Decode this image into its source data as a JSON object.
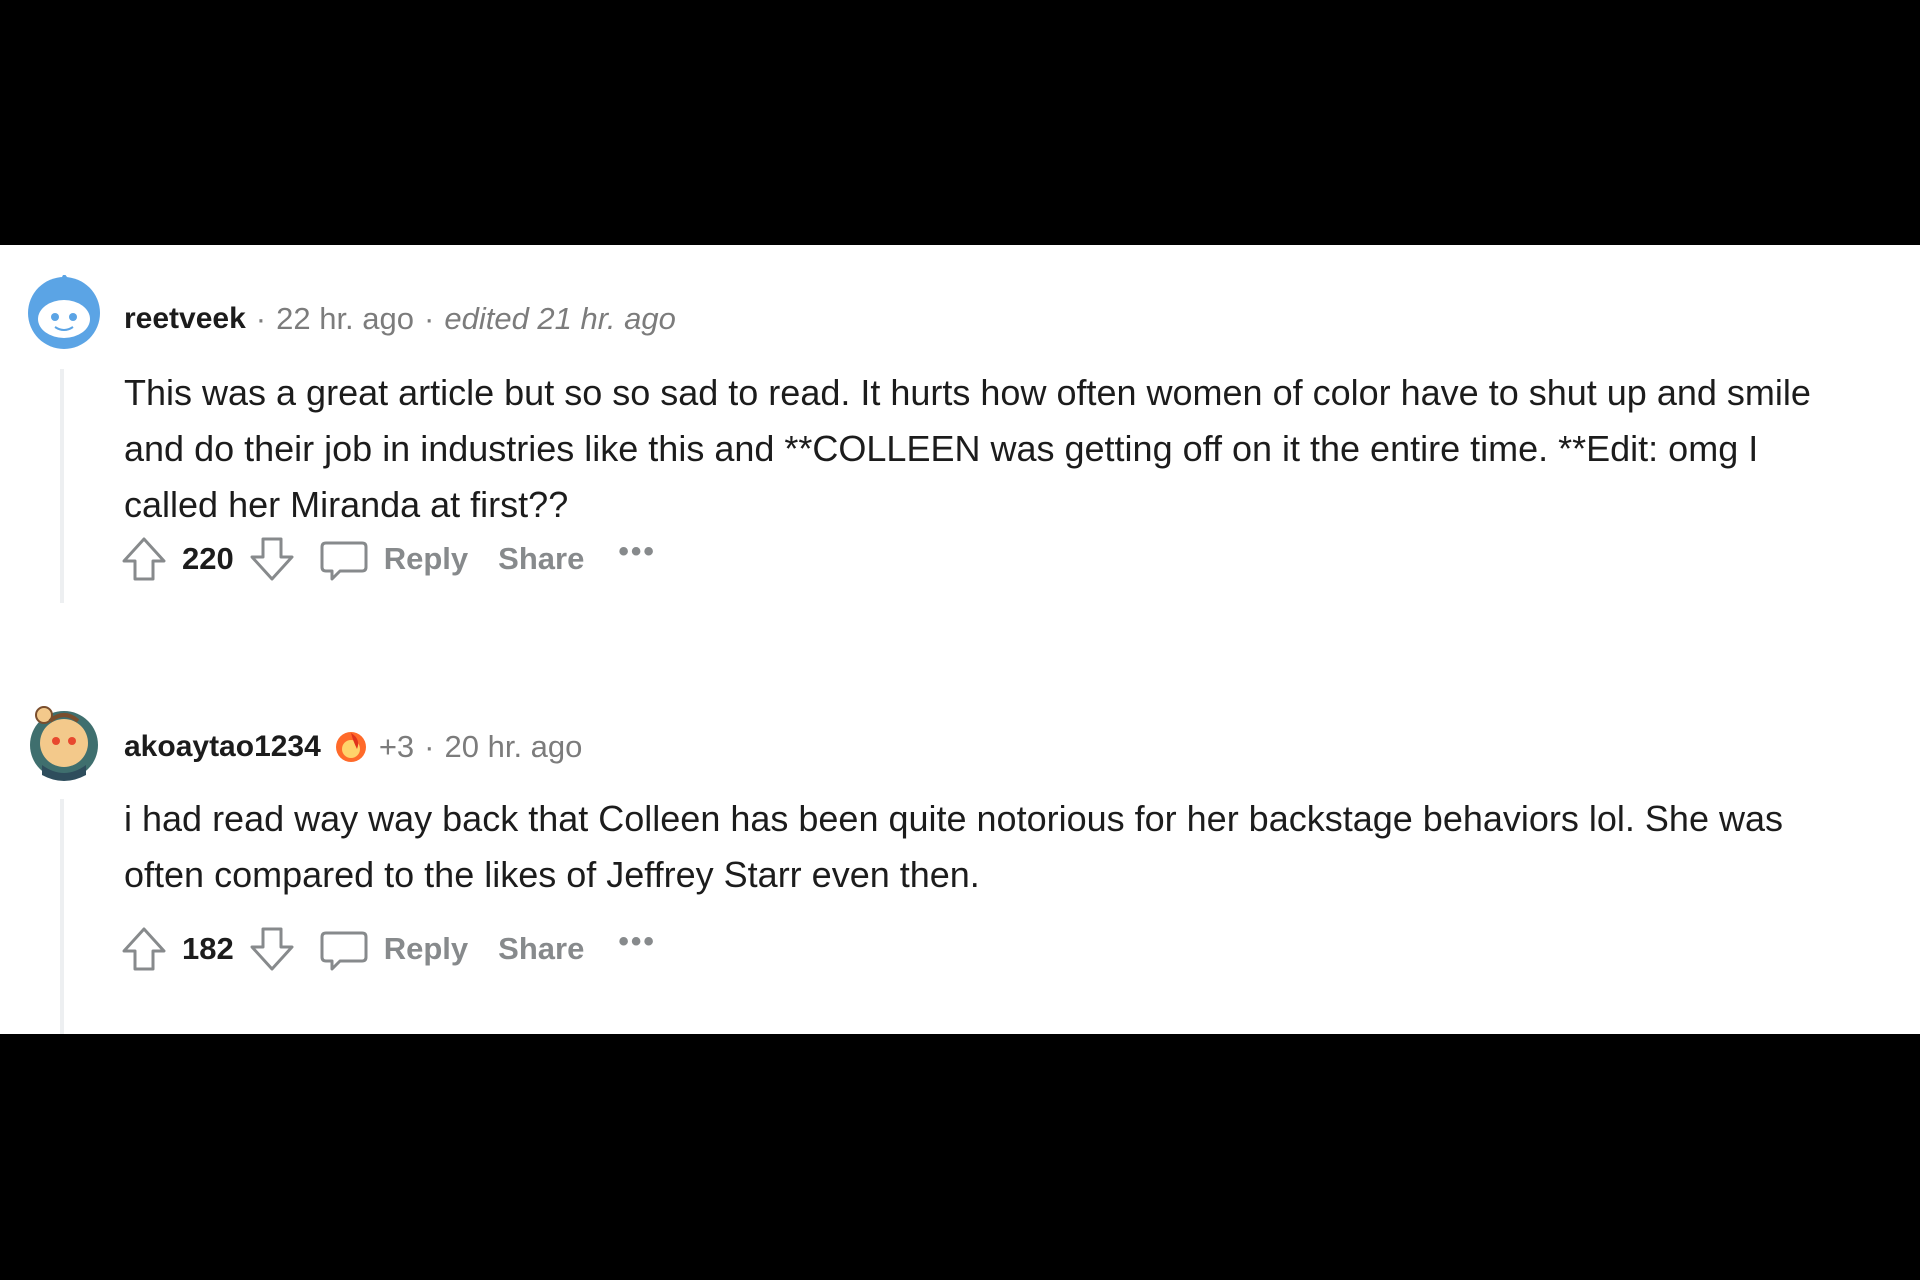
{
  "comments": [
    {
      "username": "reetveek",
      "time": "22 hr. ago",
      "edited": "edited 21 hr. ago",
      "text": "This was a great article but so so sad to read. It hurts how often women of color have to shut up and smile and do their job in industries like this and **COLLEEN was getting off on it the entire time. **Edit: omg I called her Miranda at first??",
      "score": "220",
      "reply_label": "Reply",
      "share_label": "Share",
      "more_label": "•••",
      "avatar_icon": "snoo-avatar-icon"
    },
    {
      "username": "akoaytao1234",
      "flair_icon": "achievement-flair-icon",
      "karma": "+3",
      "time": "20 hr. ago",
      "text": "i had read way way back that Colleen has been quite notorious for her backstage behaviors lol. She was often compared to the likes of Jeffrey Starr even then.",
      "score": "182",
      "reply_label": "Reply",
      "share_label": "Share",
      "more_label": "•••",
      "avatar_icon": "snoo-avatar-icon"
    }
  ],
  "colors": {
    "background": "#000000",
    "panel": "#ffffff",
    "text": "#1c1c1c",
    "meta": "#7c7c7c",
    "action": "#878a8c",
    "avatar_blue": "#5ba4e5"
  }
}
